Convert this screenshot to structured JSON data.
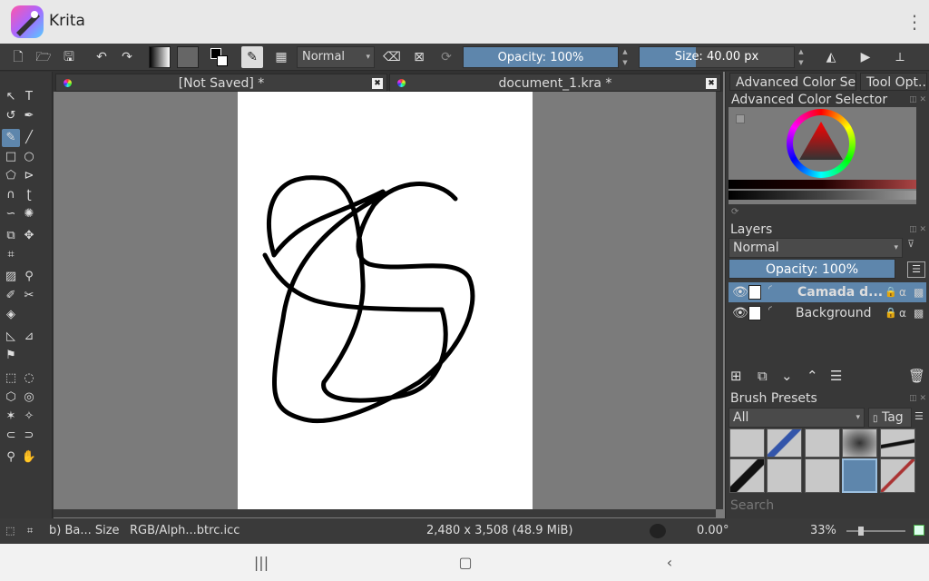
{
  "app": {
    "title": "Krita"
  },
  "toolbar": {
    "blend_mode": "Normal",
    "opacity": "Opacity: 100%",
    "size": "Size: 40.00 px"
  },
  "tabs": [
    {
      "label": "[Not Saved]  *"
    },
    {
      "label": "document_1.kra *"
    }
  ],
  "dockers": {
    "tabs": [
      {
        "label": "Advanced Color Sel..."
      },
      {
        "label": "Tool Opt..."
      }
    ],
    "color_selector_title": "Advanced Color Selector",
    "layers": {
      "title": "Layers",
      "blend_mode": "Normal",
      "opacity": "Opacity:  100%",
      "items": [
        {
          "name": "Camada d...",
          "selected": true
        },
        {
          "name": "Background",
          "selected": false
        }
      ]
    },
    "brush_presets": {
      "title": "Brush Presets",
      "filter": "All",
      "tag": "Tag",
      "search_placeholder": "Search"
    }
  },
  "status": {
    "brush": "b) Ba... Size",
    "color_profile": "RGB/Alph...btrc.icc",
    "dimensions": "2,480 x 3,508 (48.9 MiB)",
    "rotation": "0.00°",
    "zoom": "33%"
  },
  "colors": {
    "accent": "#5e86ac",
    "canvas_bg": "#7b7b7b",
    "panel_bg": "#383838"
  }
}
